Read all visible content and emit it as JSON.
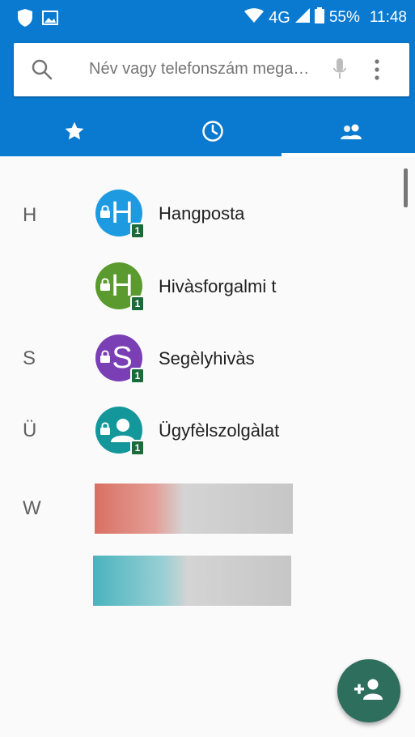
{
  "statusbar": {
    "network": "4G",
    "battery": "55%",
    "time": "11:48",
    "icons": [
      "shield-icon",
      "gallery-icon",
      "wifi-icon",
      "signal-icon",
      "battery-icon"
    ]
  },
  "search": {
    "placeholder": "Név vagy telefonszám megad…",
    "icons": [
      "search-icon",
      "mic-icon",
      "more-vert-icon"
    ]
  },
  "tabs": [
    {
      "icon": "star-icon",
      "selected": false
    },
    {
      "icon": "clock-icon",
      "selected": false
    },
    {
      "icon": "people-icon",
      "selected": true
    }
  ],
  "contacts": {
    "headers": [
      "H",
      "S",
      "Ü",
      "W"
    ],
    "items": [
      {
        "name": "Hangposta",
        "avatar_letter": "H",
        "avatar_color": "#1e9be0",
        "sim": "1"
      },
      {
        "name": "Hivàsforgalmi t",
        "avatar_letter": "H",
        "avatar_color": "#5a9a2e",
        "sim": "1"
      },
      {
        "name": "Segèlyhivàs",
        "avatar_letter": "S",
        "avatar_color": "#7b3fb5",
        "sim": "1"
      },
      {
        "name": "Ügyfèlszolgàlat",
        "avatar_icon": "person-icon",
        "avatar_color": "#14979b",
        "sim": "1"
      }
    ]
  },
  "fab": {
    "icon": "add-contact-icon"
  },
  "colors": {
    "header": "#0a7ad0",
    "fab": "#2e6e5d",
    "background": "#fafafa"
  }
}
